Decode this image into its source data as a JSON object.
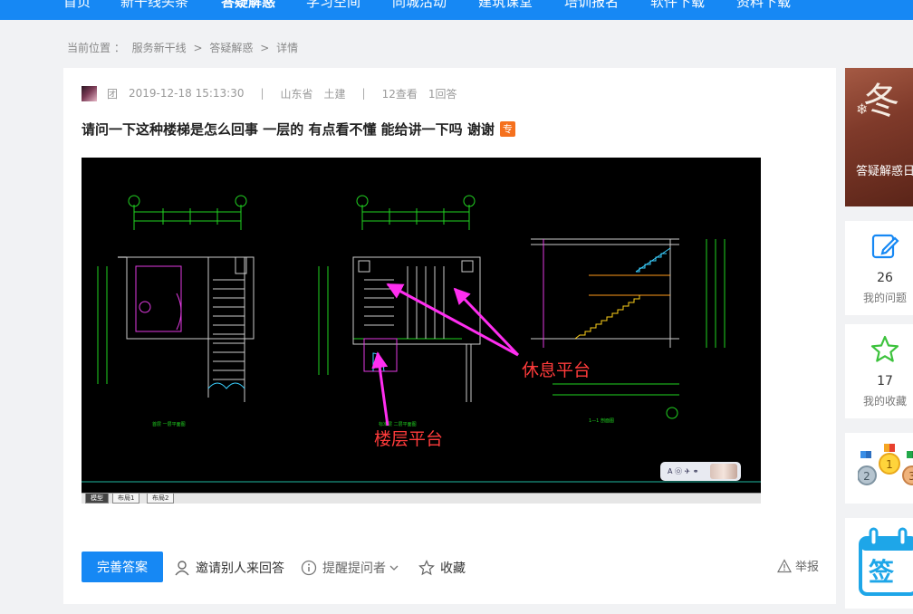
{
  "nav": {
    "items": [
      "首页",
      "新干线头条",
      "答疑解惑",
      "学习空间",
      "同城活动",
      "建筑课堂",
      "培训报名",
      "软件下载",
      "资料下载"
    ],
    "active": "答疑解惑"
  },
  "breadcrumb": {
    "prefix": "当前位置 ：",
    "items": [
      "服务新干线",
      "答疑解惑",
      "详情"
    ],
    "separator": ">"
  },
  "question": {
    "user": "团",
    "datetime": "2019-12-18 15:13:30",
    "province": "山东省",
    "category": "土建",
    "views": "12查看",
    "answers": "1回答",
    "title": "请问一下这种楼梯是怎么回事 一层的 有点看不懂 能给讲一下吗 谢谢",
    "badge": "专"
  },
  "image": {
    "callout_rest": "休息平台",
    "callout_floor": "楼层平台",
    "tabs": [
      "模型",
      "布局1",
      "布局2"
    ],
    "watermark": "A ㉧ ✈ ⚭"
  },
  "actions": {
    "complete_answer": "完善答案",
    "invite": "邀请别人来回答",
    "remind": "提醒提问者",
    "favorite": "收藏",
    "report": "举报"
  },
  "sidebar": {
    "promo_char": "冬",
    "promo_caption": "答疑解惑日",
    "my_questions_count": "26",
    "my_questions_label": "我的问题",
    "my_favorites_count": "17",
    "my_favorites_label": "我的收藏",
    "signin_char": "签"
  },
  "colors": {
    "nav_bg": "#1688f4",
    "primary": "#1688f4",
    "callout": "#ff3b3b",
    "badge": "#f5711e"
  }
}
